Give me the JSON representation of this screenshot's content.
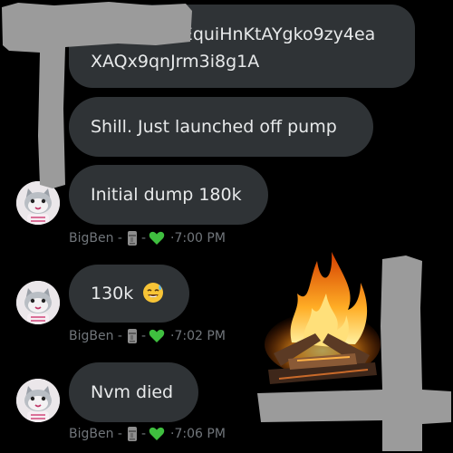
{
  "messages": [
    {
      "line1": "4qjYK11KoEquiHnKtAYgko9zy4ea",
      "line2": "XAQx9qnJrm3i8g1A"
    },
    {
      "text": "Shill. Just launched off pump"
    },
    {
      "text": "Initial dump 180k",
      "sender": "BigBen -",
      "dash": "-",
      "time": "7:00 PM"
    },
    {
      "text": "130k",
      "emoji": "sweat-smile-emoji",
      "sender": "BigBen -",
      "dash": "-",
      "time": "7:02 PM"
    },
    {
      "text": "Nvm died",
      "sender": "BigBen -",
      "dash": "-",
      "time": "7:06 PM"
    }
  ],
  "meta_icons": [
    "moai-icon",
    "green-heart-icon"
  ],
  "colors": {
    "background": "#000000",
    "bubble": "#2f3336",
    "text": "#e7e9ea",
    "meta": "#71767b",
    "heart": "#3fbf3f",
    "redaction": "#9a9a9a"
  }
}
